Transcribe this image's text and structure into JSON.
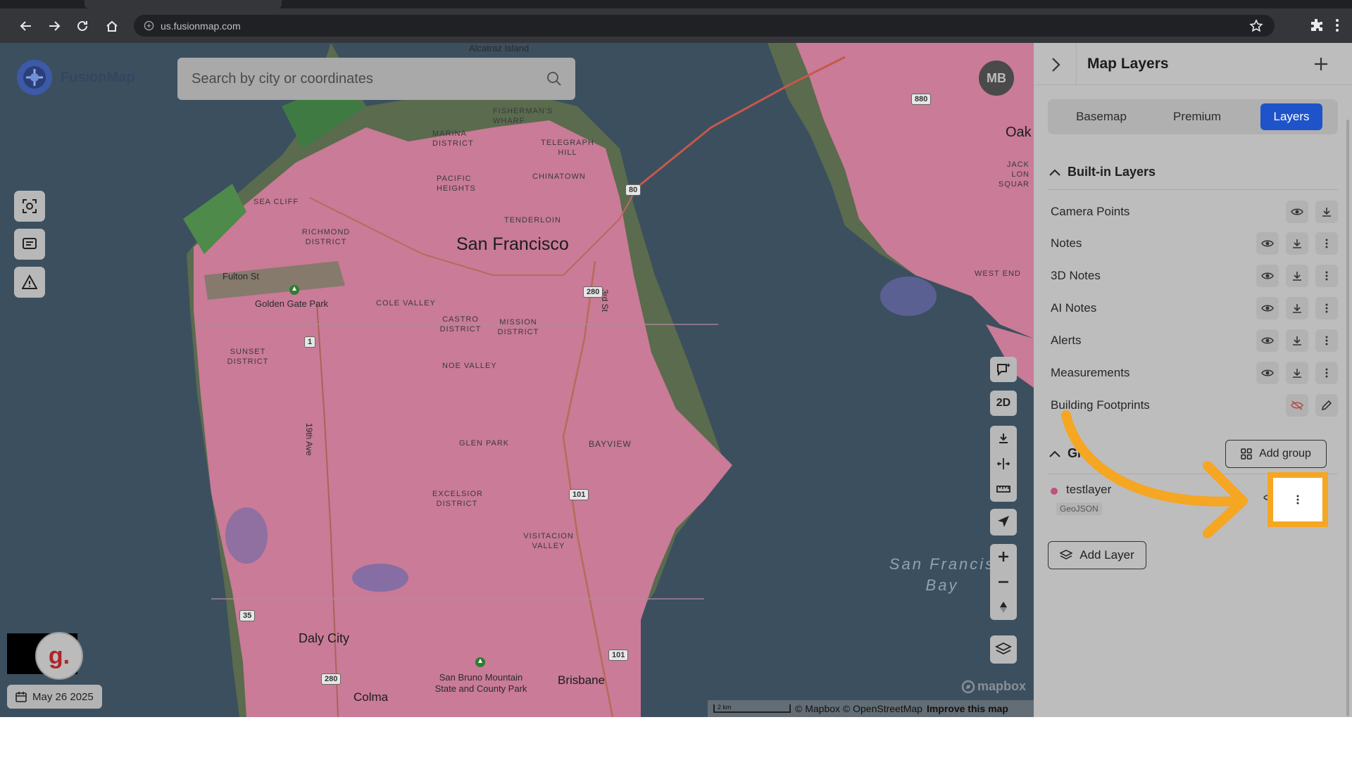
{
  "browser": {
    "url": "us.fusionmap.com"
  },
  "app": {
    "brand": "FusionMap",
    "search_placeholder": "Search by city or coordinates",
    "avatar_initials": "MB",
    "date_label": "May 26 2025",
    "grammarly_letter": "g."
  },
  "map": {
    "labels": {
      "alcatraz": "Alcatraz Island",
      "fishermans_wharf": "FISHERMAN'S WHARF",
      "marina": "MARINA DISTRICT",
      "telegraph_hill": "TELEGRAPH HILL",
      "pacific_heights": "PACIFIC HEIGHTS",
      "chinatown": "CHINATOWN",
      "sea_cliff": "SEA CLIFF",
      "richmond": "RICHMOND DISTRICT",
      "tenderloin": "TENDERLOIN",
      "san_francisco": "San Francisco",
      "fulton": "Fulton St",
      "golden_gate_park": "Golden Gate Park",
      "cole_valley": "COLE VALLEY",
      "castro": "CASTRO DISTRICT",
      "mission": "MISSION DISTRICT",
      "sunset": "SUNSET DISTRICT",
      "noe_valley": "NOE VALLEY",
      "third_st": "3rd St",
      "glen_park": "GLEN PARK",
      "bayview": "BAYVIEW",
      "nineteenth_ave": "19th Ave",
      "excelsior": "EXCELSIOR DISTRICT",
      "visitacion": "VISITACION VALLEY",
      "daly_city": "Daly City",
      "san_bruno": "San Bruno Mountain State and County Park",
      "brisbane": "Brisbane",
      "colma": "Colma",
      "oakland": "Oak",
      "jack_london": "JACK LON SQUAR",
      "west_end": "WEST END",
      "sf_bay": "San Francis Bay"
    },
    "shields": {
      "i80": "80",
      "i280_top": "280",
      "i880": "880",
      "r1": "1",
      "us101": "101",
      "i35": "35",
      "i280_bottom": "280",
      "us101_bottom": "101"
    },
    "tools_right": {
      "view_mode": "2D"
    },
    "attribution": {
      "scale": "2 km",
      "copyright": "© Mapbox © OpenStreetMap",
      "improve": "Improve this map",
      "mapbox_logo": "mapbox"
    }
  },
  "panel": {
    "title": "Map Layers",
    "tabs": [
      {
        "label": "Basemap",
        "active": false
      },
      {
        "label": "Premium",
        "active": false
      },
      {
        "label": "Layers",
        "active": true
      }
    ],
    "builtin_title": "Built-in Layers",
    "builtin_layers": [
      {
        "name": "Camera Points"
      },
      {
        "name": "Notes"
      },
      {
        "name": "3D Notes"
      },
      {
        "name": "AI Notes"
      },
      {
        "name": "Alerts"
      },
      {
        "name": "Measurements"
      },
      {
        "name": "Building Footprints"
      }
    ],
    "groups_title_visible": "Gi",
    "add_group_label": "Add group",
    "custom_layer": {
      "name": "testlayer",
      "type_tag": "GeoJSON",
      "color": "#c0507e"
    },
    "add_layer_label": "Add Layer"
  },
  "colors": {
    "accent": "#1f53c9",
    "highlight": "#f5a623",
    "layer_overlay": "#c97b97"
  }
}
